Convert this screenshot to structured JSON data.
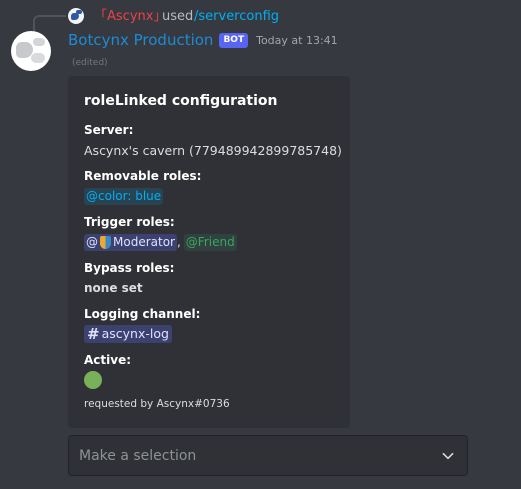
{
  "reply": {
    "user": "「Ascynx」",
    "used_text": "used",
    "command": "/serverconfig"
  },
  "message": {
    "author": "Botcynx Production",
    "bot_tag": "BOT",
    "timestamp": "Today at 13:41",
    "edited": "(edited)"
  },
  "embed": {
    "title": "roleLinked configuration",
    "fields": {
      "server": {
        "name": "Server:",
        "value": "Ascynx's cavern (779489942899785748)"
      },
      "removable": {
        "name": "Removable roles:",
        "role": "@color: blue"
      },
      "trigger": {
        "name": "Trigger roles:",
        "role_at": "@",
        "role1": "Moderator",
        "separator": ",",
        "role2": "@Friend"
      },
      "bypass": {
        "name": "Bypass roles:",
        "value": "none set"
      },
      "logging": {
        "name": "Logging channel:",
        "channel": "ascynx-log"
      },
      "active": {
        "name": "Active:",
        "state_color": "#78b159"
      }
    },
    "footer": "requested by Ascynx#0736"
  },
  "select": {
    "placeholder": "Make a selection"
  },
  "colors": {
    "background": "#36393f",
    "embed_bg": "#2f3136",
    "bot_name": "#1e8bd6",
    "bot_tag": "#5865f2",
    "link": "#00aff4",
    "reply_user": "#ed4245"
  }
}
